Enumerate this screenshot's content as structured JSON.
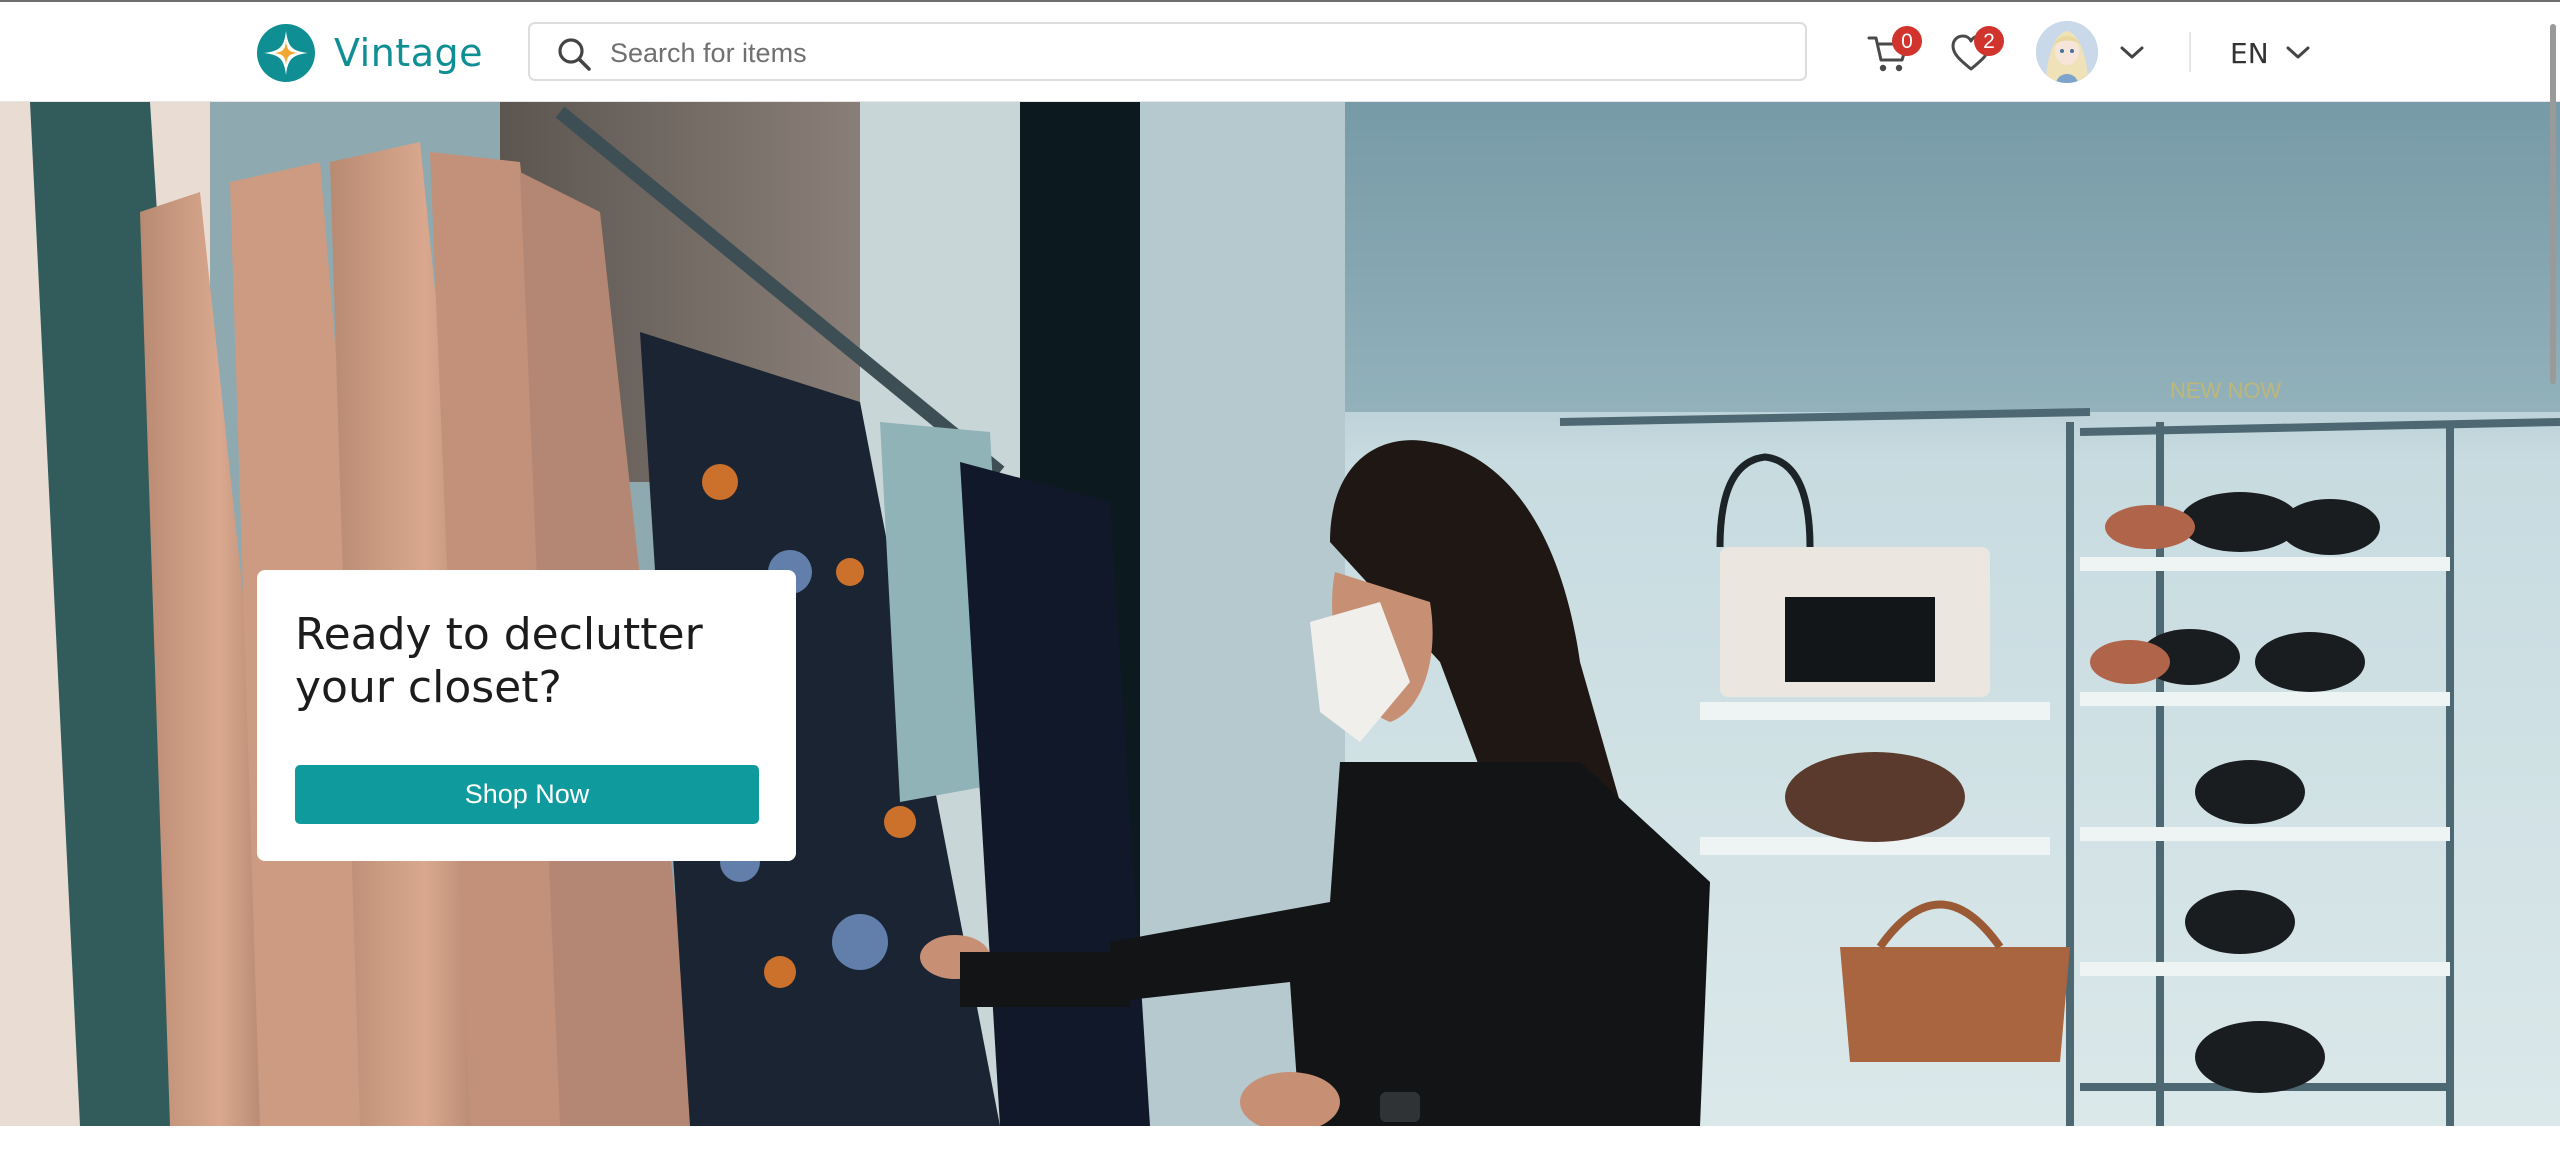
{
  "brand": {
    "name": "Vintage",
    "logo_icon": "vintage-star-logo",
    "accent_color": "#0f9a9d"
  },
  "search": {
    "placeholder": "Search for items",
    "value": "",
    "icon": "search-icon"
  },
  "cart": {
    "icon": "cart-icon",
    "count": "0"
  },
  "favorites": {
    "icon": "heart-icon",
    "count": "2"
  },
  "user": {
    "avatar_icon": "avatar",
    "menu_icon": "chevron-down-icon"
  },
  "language": {
    "label": "EN",
    "menu_icon": "chevron-down-icon"
  },
  "hero": {
    "title": "Ready to declutter your closet?",
    "cta_label": "Shop Now",
    "store_sign": "NEW NOW"
  },
  "colors": {
    "badge": "#d0342c",
    "text_dark": "#1c1c1c",
    "placeholder": "#707070"
  }
}
